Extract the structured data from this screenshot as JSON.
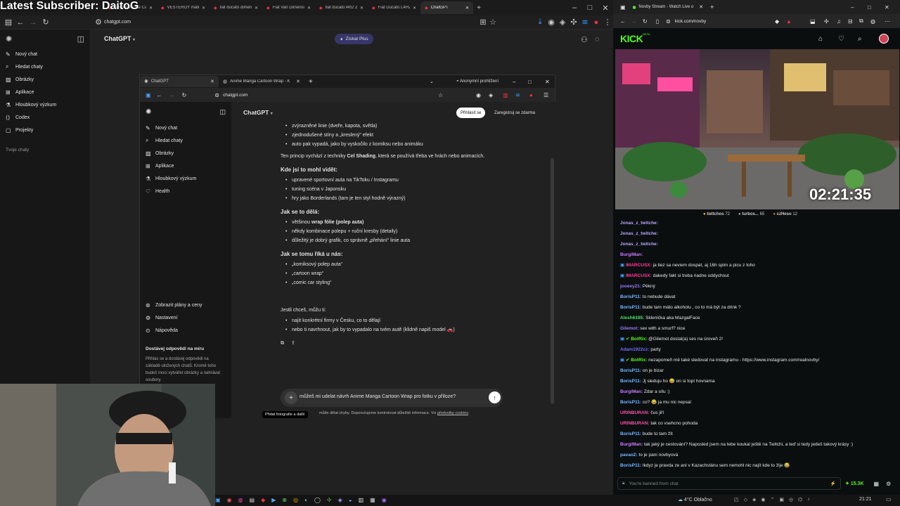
{
  "overlay_title": "Latest Subscriber: DaitoG",
  "left_browser": {
    "tabs": [
      {
        "label": "Attempted the Ca"
      },
      {
        "label": "VESTERÖY matrac"
      },
      {
        "label": "fiat ducato dimen"
      },
      {
        "label": "Fiat Van Dimensio"
      },
      {
        "label": "fiat ducato l4h2 20"
      },
      {
        "label": "Fiat Ducato L4H2"
      },
      {
        "label": "ChatGPT"
      }
    ],
    "url": "chatgpt.com"
  },
  "outer_chatgpt": {
    "title": "ChatGPT",
    "plus_button": "Získat Plus",
    "sidebar": [
      {
        "label": "Nový chat"
      },
      {
        "label": "Hledat chaty"
      },
      {
        "label": "Obrázky"
      },
      {
        "label": "Aplikace"
      },
      {
        "label": "Hloubkový výzkum"
      },
      {
        "label": "Codex"
      },
      {
        "label": "Projekty"
      }
    ],
    "my_chats": "Tvoje chaty"
  },
  "inner_browser": {
    "tabs": [
      {
        "label": "ChatGPT"
      },
      {
        "label": "Anime Manga Cartoon Wrap - K"
      }
    ],
    "incognito": "Anonymní prohlížení",
    "url": "chatgpt.com"
  },
  "inner_chatgpt": {
    "title": "ChatGPT",
    "login": "Přihlásit se",
    "register": "Zaregistruj se zdarma",
    "sidebar": [
      {
        "label": "Nový chat"
      },
      {
        "label": "Hledat chaty"
      },
      {
        "label": "Obrázky"
      },
      {
        "label": "Aplikace"
      },
      {
        "label": "Hloubkový výzkum"
      },
      {
        "label": "Health"
      }
    ],
    "sidebar_bottom": [
      {
        "label": "Zobrazit plány a ceny"
      },
      {
        "label": "Nastavení"
      },
      {
        "label": "Nápověda"
      }
    ],
    "promo_title": "Dostávej odpovědi na míru",
    "promo_text": "Přihlas se a dostávej odpovědi na základě uložených chatů. Kromě toho budeš moci vytvářet obrázky a nahrávat soubory.",
    "message": {
      "list1": [
        "zvýrazněné linie (dveře, kapota, světla)",
        "zjednodušené stíny a „kreslený“ efekt",
        "auto pak vypadá, jako by vyskočilo z komiksu nebo animáku"
      ],
      "para1_a": "Ten princip vychází z techniky ",
      "para1_b": "Cel Shading",
      "para1_c": ", která se používá třeba ve hrách nebo animacích.",
      "h1": "Kde jsi to mohl vidět:",
      "list2": [
        "upravené sportovní auta na TikToku / Instagramu",
        "tuning scéna v Japonsku",
        "hry jako Borderlands (tam je ten styl hodně výrazný)"
      ],
      "h2": "Jak se to dělá:",
      "list3_0a": "většinou ",
      "list3_0b": "wrap fólie (polep auta)",
      "list3": [
        "někdy kombinace polepu + ruční kresby (detaily)",
        "důležitý je dobrý grafik, co správně „přehání“ linie auta"
      ],
      "h3": "Jak se tomu říká u nás:",
      "list4": [
        "„komiksový polep auta“",
        "„cartoon wrap“",
        "„comic car styling“"
      ],
      "para2": "Jestli chceš, můžu ti:",
      "list5": [
        "najít konkrétní firmy v Česku, co to dělají",
        "nebo ti navrhnout, jak by to vypadalo na tvém autě (klidně napiš model 🚗)"
      ]
    },
    "composer_text": "můžeš mi udelat návrh Anime Manga Cartoon Wrap pro fotku v příloze?",
    "tooltip": "Přidat fotografie a další",
    "disclaimer_a": "může dělat chyby. Doporučujeme kontrolovat důležité informace. Viz ",
    "disclaimer_b": "předvolby cookies",
    "disclaimer_c": "."
  },
  "kick": {
    "window_title": "Novby Stream - Watch Live o",
    "url": "kick.com/novby",
    "logo": "KICK",
    "beta": "BETA",
    "timer": "02:21:35",
    "stats": [
      {
        "name": "twitchos",
        "count": "72"
      },
      {
        "name": "turbos...",
        "count": "65"
      },
      {
        "name": "czHeso",
        "count": "12"
      }
    ],
    "chat": [
      {
        "user": "Jonas_z_twitche:",
        "text": "",
        "color": "#b9a6ff"
      },
      {
        "user": "Jonas_z_twitche:",
        "text": "",
        "color": "#b9a6ff"
      },
      {
        "user": "Jonas_z_twitche:",
        "text": "",
        "color": "#b9a6ff"
      },
      {
        "user": "BurgiMan:",
        "text": "",
        "color": "#c77dff"
      },
      {
        "user": "IMARCUSX:",
        "text": "ja tiez sa neviem dospat, aj 16h spim a picu z toho",
        "color": "#ff3b9a"
      },
      {
        "user": "IMARCUSX:",
        "text": "dakedy fakt si treba riadne oddychnut",
        "color": "#ff3b9a"
      },
      {
        "user": "jooeey21:",
        "text": "Pěkný",
        "color": "#9b7bff"
      },
      {
        "user": "BorisP11:",
        "text": "to nebude dávat",
        "color": "#7ab8ff"
      },
      {
        "user": "BorisP11:",
        "text": "bude tam málo alkoholu , co to má být za drink ?",
        "color": "#7ab8ff"
      },
      {
        "user": "Alesh6195:",
        "text": "Sklenička aka MazgalFace",
        "color": "#52e06b"
      },
      {
        "user": "Gilemot:",
        "text": "sex with a smurf? nice",
        "color": "#9b7bff"
      },
      {
        "user": "BotRix:",
        "text": "@Gilemot dostal(a) ses na úroveň 2!",
        "color": "#53fc18"
      },
      {
        "user": "Adam1922cz:",
        "text": "party",
        "color": "#6f6bff"
      },
      {
        "user": "BotRix:",
        "text": "nezapomeň mě také sledovat na instagramu - https://www.instagram.com/realnovby/",
        "color": "#53fc18"
      },
      {
        "user": "BorisP11:",
        "text": "on je bizar",
        "color": "#7ab8ff"
      },
      {
        "user": "BorisP11:",
        "text": "Jj sleduju ho 😂 on si topí hovnama",
        "color": "#7ab8ff"
      },
      {
        "user": "BurgiMan:",
        "text": "Zdar a sílu :)",
        "color": "#c77dff"
      },
      {
        "user": "BorisP11:",
        "text": "co? 😂 ja mu nic nepsal",
        "color": "#7ab8ff"
      },
      {
        "user": "URINBURAN:",
        "text": "čus jiří",
        "color": "#ff4fb0"
      },
      {
        "user": "URINBURAN:",
        "text": "tak co vsehcno pohoda",
        "color": "#ff4fb0"
      },
      {
        "user": "BorisP11:",
        "text": "bude to tam žít",
        "color": "#7ab8ff"
      },
      {
        "user": "BurgiMan:",
        "text": "tak jaký je cestování? Naposled jsem na tebe koukal ještě na Twitchi, a teď si tedy jedeš takový krásy :)",
        "color": "#c77dff"
      },
      {
        "user": "pavao2:",
        "text": "to je pani novbyová",
        "color": "#7ab8ff"
      },
      {
        "user": "BorisP11:",
        "text": "Ikdyz je pravda ze ani v Kazachstánu sem nemohl nic najít kde to žije 😂",
        "color": "#7ab8ff"
      }
    ],
    "banned": "You're banned from chat",
    "viewers": "15.3K"
  },
  "taskbar": {
    "weather": "4°C Oblačno",
    "time": "21:21"
  }
}
